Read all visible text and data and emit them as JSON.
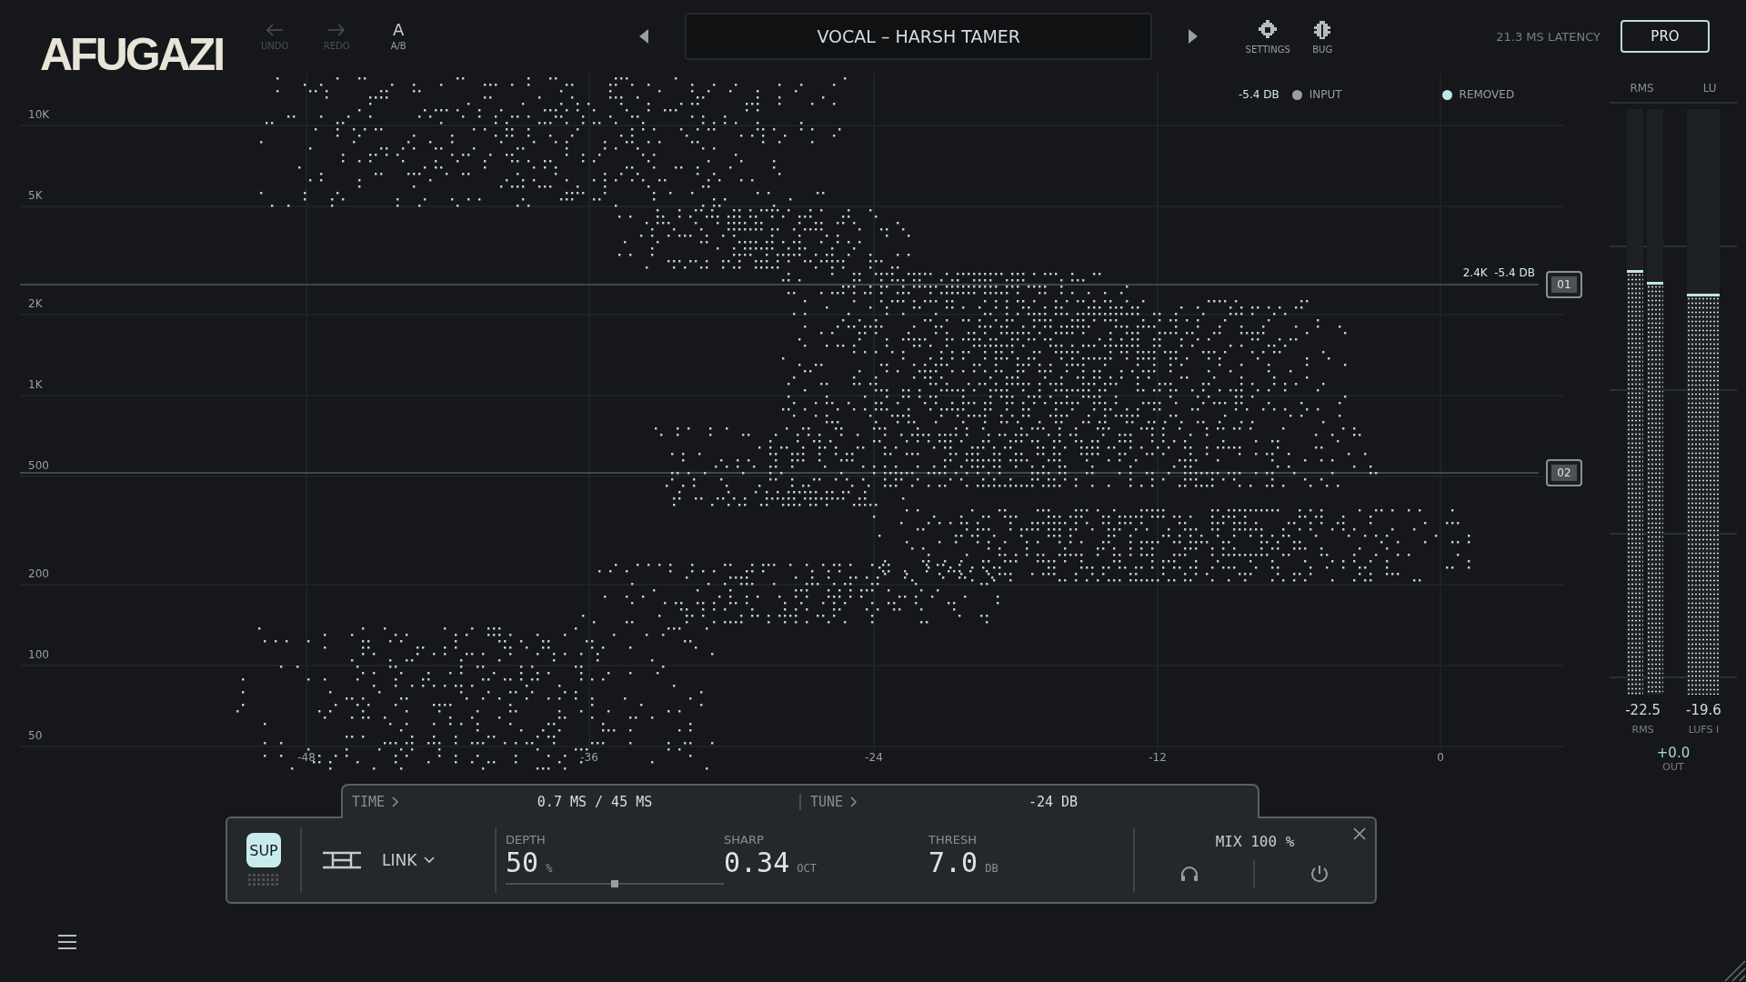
{
  "logo": "AFUGAZI",
  "toolbar": [
    {
      "kind": "undo",
      "label": "UNDO",
      "disabled": true
    },
    {
      "kind": "redo",
      "label": "REDO",
      "disabled": true
    },
    {
      "kind": "ab",
      "glyph": "A",
      "label": "A/B",
      "disabled": false
    }
  ],
  "preset": {
    "name": "VOCAL – HARSH TAMER"
  },
  "tools": [
    {
      "kind": "gear",
      "label": "SETTINGS"
    },
    {
      "kind": "bug",
      "label": "BUG"
    }
  ],
  "latency": "21.3 MS LATENCY",
  "pro_button": "PRO",
  "legend": {
    "reading": "-5.4 DB",
    "items": [
      {
        "label": "INPUT",
        "color": "#9a9ea2"
      },
      {
        "label": "REMOVED",
        "color": "#bfe6ea"
      }
    ]
  },
  "spectrum": {
    "y_labels": [
      "10K",
      "5K",
      "2K",
      "1K",
      "500",
      "200",
      "100",
      "50"
    ],
    "x_labels": [
      "-48",
      "-36",
      "-24",
      "-12",
      "0"
    ],
    "bands": [
      {
        "id": "01",
        "reading": "2.4K  -5.4 DB"
      },
      {
        "id": "02"
      }
    ]
  },
  "panel": {
    "tabs": [
      {
        "label": "TIME",
        "value": "0.7 MS / 45 MS"
      },
      {
        "label": "TUNE",
        "value": "-24 DB"
      }
    ],
    "mode_button": {
      "label": "SUP",
      "on": true
    },
    "link": "LINK",
    "params": [
      {
        "label": "DEPTH",
        "value": "50",
        "unit": "%",
        "level": 0.5
      },
      {
        "label": "SHARP",
        "value": "0.34",
        "unit": "OCT"
      },
      {
        "label": "THRESH",
        "value": "7.0",
        "unit": "DB"
      }
    ],
    "mix": "MIX 100 %"
  },
  "meters": {
    "headers": [
      "RMS",
      "LU"
    ],
    "rms_bars": [
      {
        "level": 0.72
      },
      {
        "level": 0.7
      }
    ],
    "lu_bars": [
      {
        "level": 0.68
      }
    ],
    "readings": [
      {
        "value": "-22.5",
        "label": "RMS"
      },
      {
        "value": "-19.6",
        "label": "LUFS I"
      }
    ],
    "out": {
      "value": "+0.0",
      "label": "OUT"
    }
  }
}
